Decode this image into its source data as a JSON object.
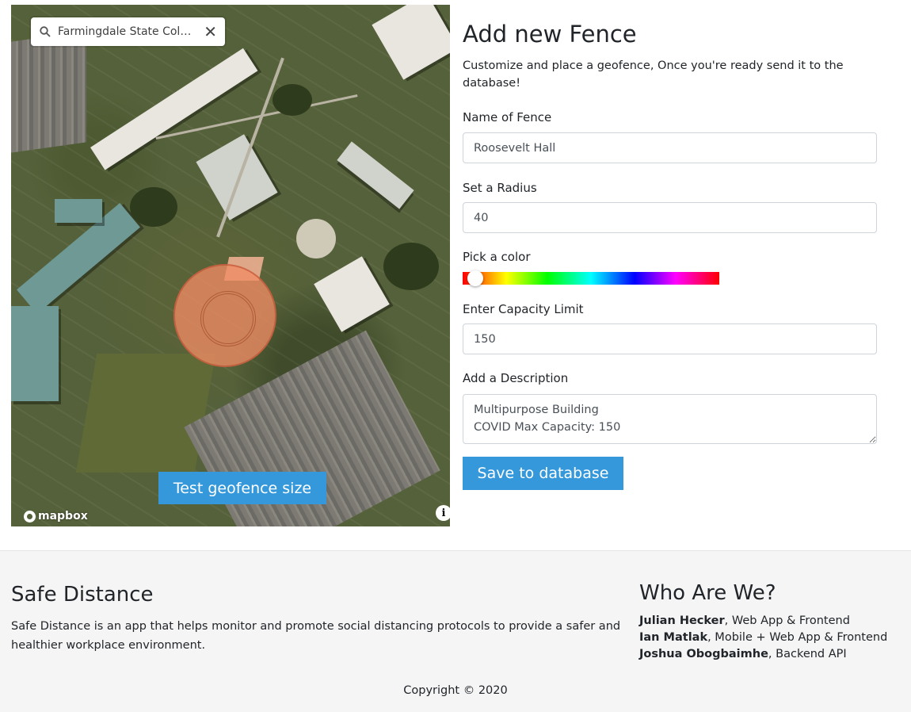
{
  "map": {
    "search": {
      "value": "Farmingdale State Coll...",
      "placeholder": "Search"
    },
    "test_button_label": "Test geofence size",
    "attribution_logo": "mapbox",
    "icons": {
      "search": "search-icon",
      "close": "close-icon",
      "info": "info-icon",
      "logo": "mapbox-logo-icon"
    },
    "fence_color": "#f08c64"
  },
  "form": {
    "title": "Add new Fence",
    "intro": "Customize and place a geofence, Once you're ready send it to the database!",
    "name": {
      "label": "Name of Fence",
      "value": "Roosevelt Hall"
    },
    "radius": {
      "label": "Set a Radius",
      "value": "40"
    },
    "color": {
      "label": "Pick a color",
      "hue_value": 0.05
    },
    "capacity": {
      "label": "Enter Capacity Limit",
      "value": "150"
    },
    "description": {
      "label": "Add a Description",
      "value": "Multipurpose Building\nCOVID Max Capacity: 150"
    },
    "save_label": "Save to database",
    "accent": "#3498db"
  },
  "footer": {
    "title": "Safe Distance",
    "about": "Safe Distance is an app that helps monitor and promote social distancing protocols to provide a safer and healthier workplace environment.",
    "who_title": "Who Are We?",
    "team": [
      {
        "name": "Julian Hecker",
        "role": ", Web App & Frontend"
      },
      {
        "name": "Ian Matlak",
        "role": ", Mobile + Web App & Frontend"
      },
      {
        "name": "Joshua Obogbaimhe",
        "role": ", Backend API"
      }
    ],
    "copyright": "Copyright © 2020"
  }
}
